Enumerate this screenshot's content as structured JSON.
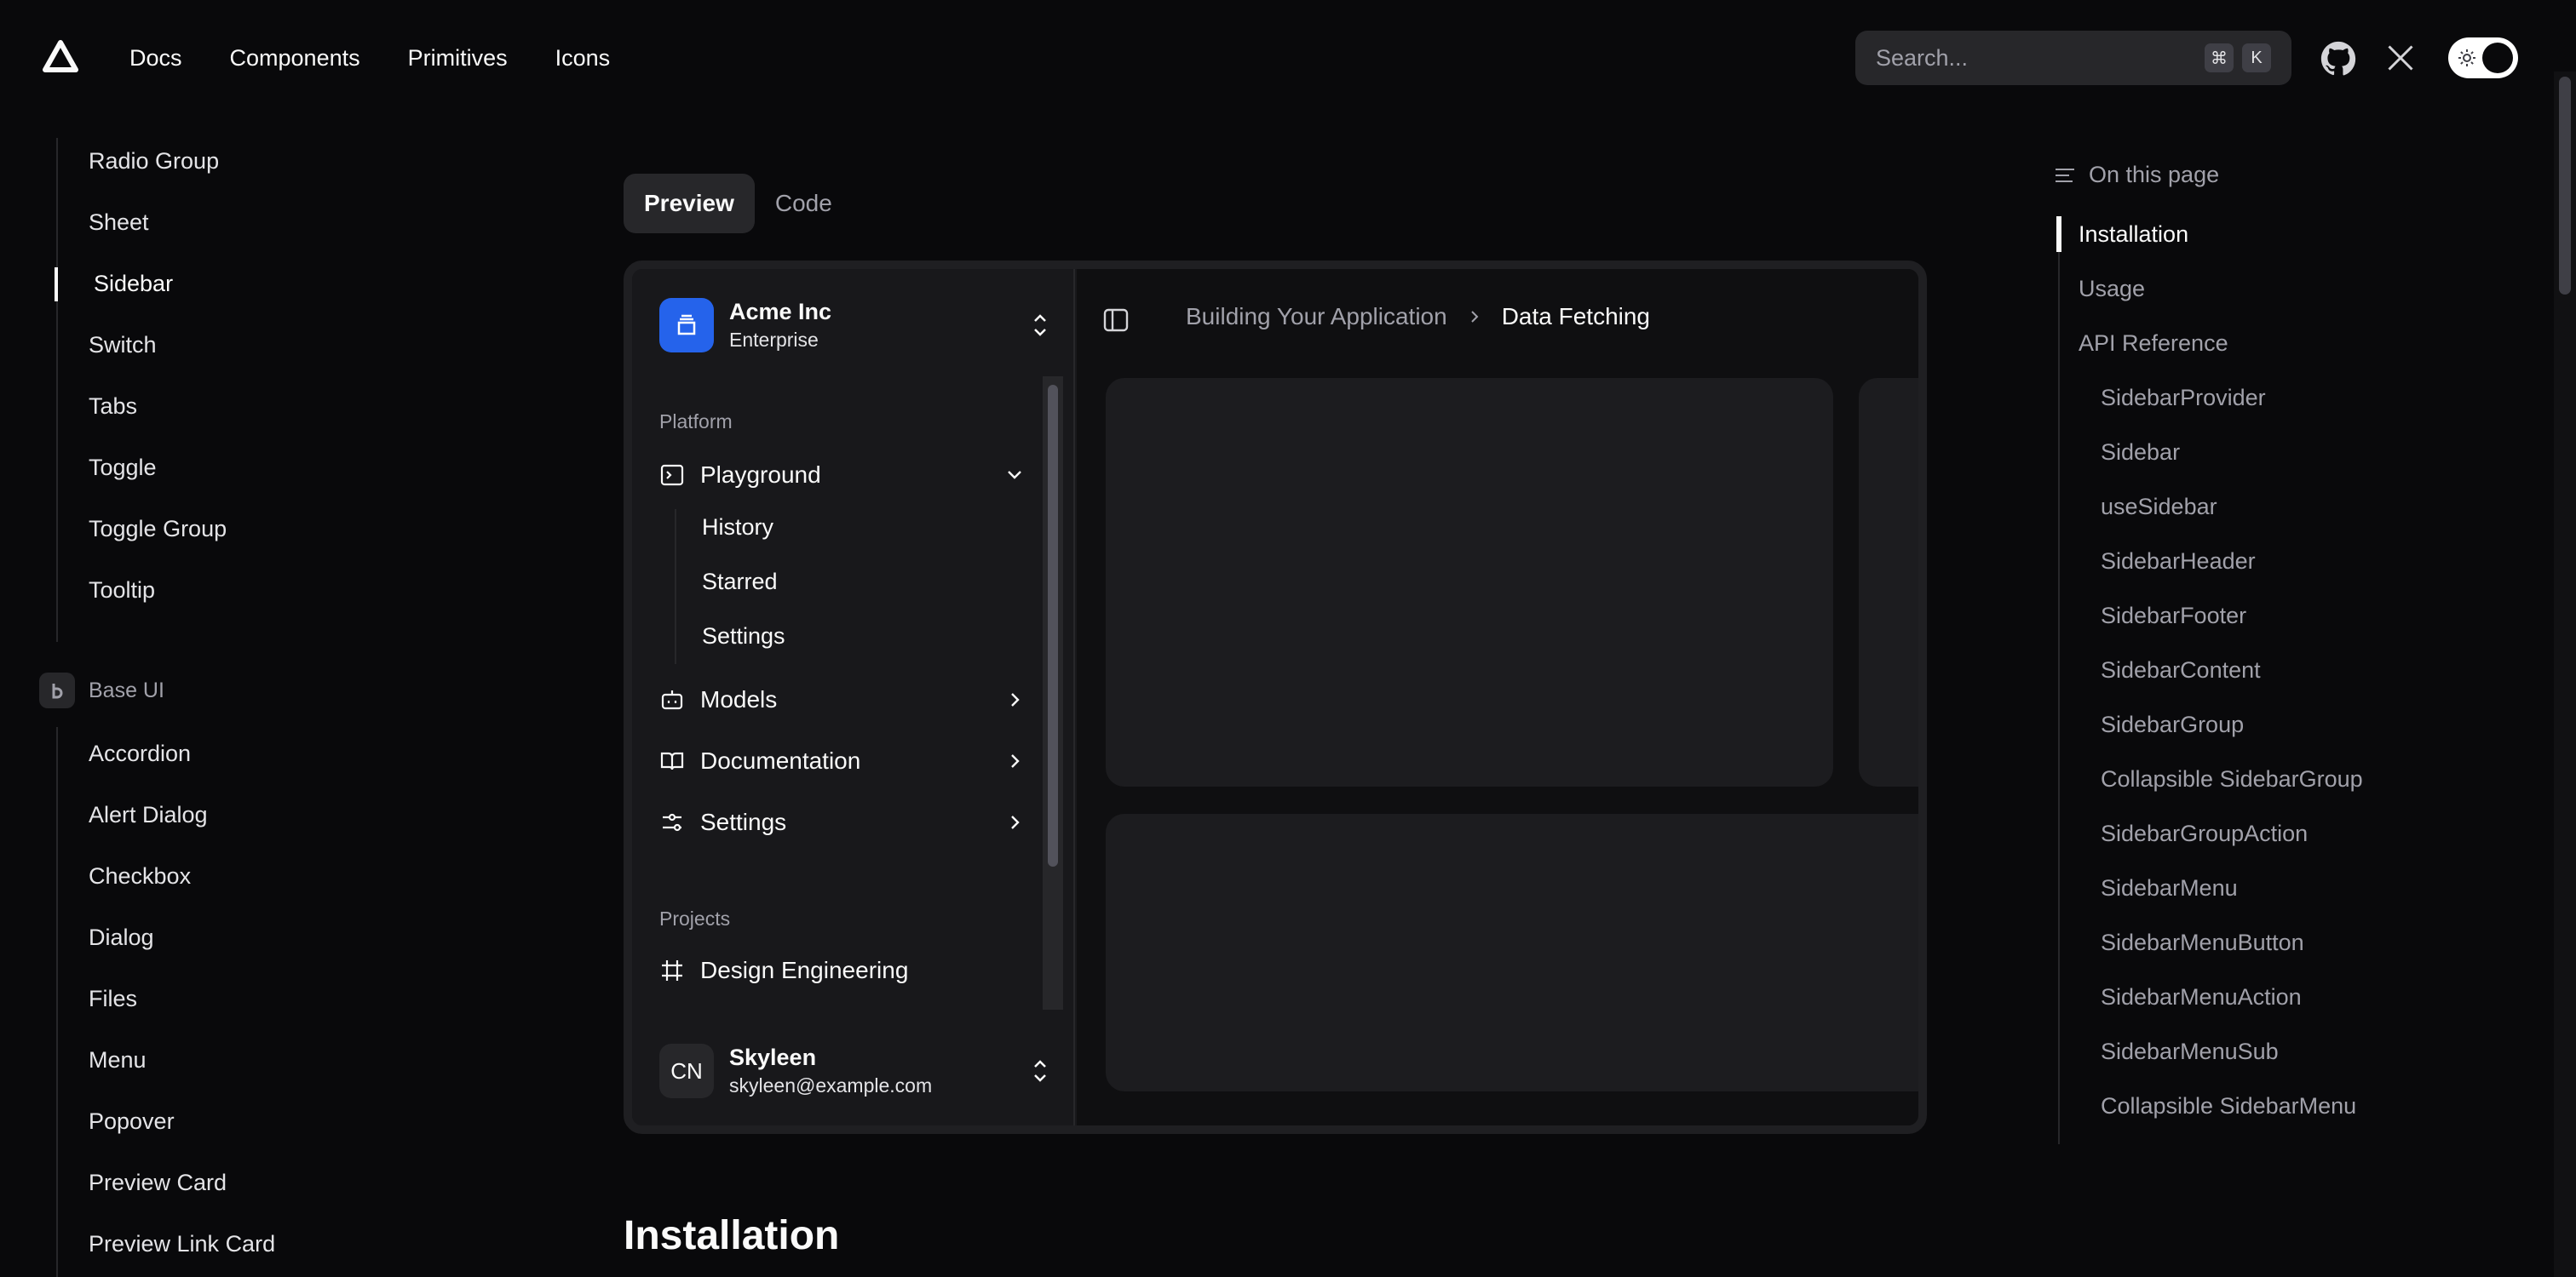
{
  "topbar": {
    "nav": [
      "Docs",
      "Components",
      "Primitives",
      "Icons"
    ],
    "search_placeholder": "Search...",
    "shortcut_keys": [
      "⌘",
      "K"
    ]
  },
  "leftnav": {
    "items_top": [
      "Radio Group",
      "Sheet",
      "Sidebar",
      "Switch",
      "Tabs",
      "Toggle",
      "Toggle Group",
      "Tooltip"
    ],
    "active_item": "Sidebar",
    "group_label": "Base UI",
    "items_bottom": [
      "Accordion",
      "Alert Dialog",
      "Checkbox",
      "Dialog",
      "Files",
      "Menu",
      "Popover",
      "Preview Card",
      "Preview Link Card"
    ]
  },
  "tabs": [
    "Preview",
    "Code"
  ],
  "demo": {
    "team": {
      "name": "Acme Inc",
      "plan": "Enterprise"
    },
    "platform_label": "Platform",
    "menu": [
      {
        "label": "Playground",
        "icon": "terminal-icon"
      },
      {
        "label": "Models",
        "icon": "bot-icon"
      },
      {
        "label": "Documentation",
        "icon": "book-icon"
      },
      {
        "label": "Settings",
        "icon": "sliders-icon"
      }
    ],
    "submenu": [
      "History",
      "Starred",
      "Settings"
    ],
    "projects_label": "Projects",
    "projects": [
      "Design Engineering"
    ],
    "user": {
      "initials": "CN",
      "name": "Skyleen",
      "email": "skyleen@example.com"
    },
    "breadcrumb": {
      "parent": "Building Your Application",
      "current": "Data Fetching"
    }
  },
  "toc": {
    "title": "On this page",
    "items": [
      {
        "label": "Installation",
        "level": 1
      },
      {
        "label": "Usage",
        "level": 1
      },
      {
        "label": "API Reference",
        "level": 1
      },
      {
        "label": "SidebarProvider",
        "level": 2
      },
      {
        "label": "Sidebar",
        "level": 2
      },
      {
        "label": "useSidebar",
        "level": 2
      },
      {
        "label": "SidebarHeader",
        "level": 2
      },
      {
        "label": "SidebarFooter",
        "level": 2
      },
      {
        "label": "SidebarContent",
        "level": 2
      },
      {
        "label": "SidebarGroup",
        "level": 2
      },
      {
        "label": "Collapsible SidebarGroup",
        "level": 2
      },
      {
        "label": "SidebarGroupAction",
        "level": 2
      },
      {
        "label": "SidebarMenu",
        "level": 2
      },
      {
        "label": "SidebarMenuButton",
        "level": 2
      },
      {
        "label": "SidebarMenuAction",
        "level": 2
      },
      {
        "label": "SidebarMenuSub",
        "level": 2
      },
      {
        "label": "Collapsible SidebarMenu",
        "level": 2
      }
    ]
  },
  "section_heading": "Installation",
  "colors": {
    "background": "#09090b",
    "accent": "#2563eb",
    "muted": "#a1a1aa"
  }
}
